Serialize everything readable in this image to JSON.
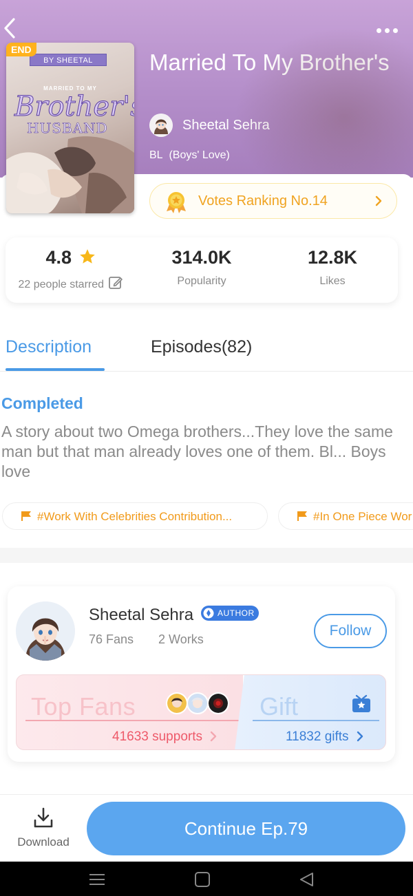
{
  "header": {
    "title": "Married To My Brother's",
    "author_name": "Sheetal Sehra",
    "genre": "BL  (Boys' Love)"
  },
  "cover": {
    "badge": "END",
    "by_line": "BY SHEETAL",
    "married_to_my": "MARRIED TO MY",
    "script_title": "Brother's",
    "husband": "HUSBAND"
  },
  "votes": {
    "label": "Votes Ranking No.14"
  },
  "stats": {
    "rating": "4.8",
    "rating_label": "22 people starred",
    "popularity": "314.0K",
    "popularity_label": "Popularity",
    "likes": "12.8K",
    "likes_label": "Likes"
  },
  "tabs": [
    {
      "label": "Description",
      "active": true
    },
    {
      "label": "Episodes(82)",
      "active": false
    }
  ],
  "description": {
    "status": "Completed",
    "text": "A story about two Omega brothers...They love the same man but that man already loves one of them. Bl... Boys love"
  },
  "tags": [
    {
      "label": "#Work With Celebrities Contribution..."
    },
    {
      "label": "#In One Piece Wor"
    }
  ],
  "author_card": {
    "name": "Sheetal Sehra",
    "badge": "AUTHOR",
    "fans": "76 Fans",
    "works": "2 Works",
    "follow_label": "Follow",
    "top_fans_label": "Top Fans",
    "supports": "41633 supports",
    "gift_label": "Gift",
    "gifts": "11832 gifts"
  },
  "bottom": {
    "download_label": "Download",
    "continue_label": "Continue Ep.79"
  },
  "colors": {
    "accent_blue": "#4a9ae6",
    "button_blue": "#5ba6ef",
    "gold": "#f0a320",
    "tag_orange": "#f19a1a",
    "fans_red": "#ee5a6a"
  },
  "icons": [
    "back-icon",
    "more-icon",
    "medal-icon",
    "chevron-right-icon",
    "star-icon",
    "edit-icon",
    "flag-icon",
    "author-badge-icon",
    "gift-icon",
    "download-icon",
    "menu-icon",
    "home-icon",
    "back-triangle-icon"
  ]
}
